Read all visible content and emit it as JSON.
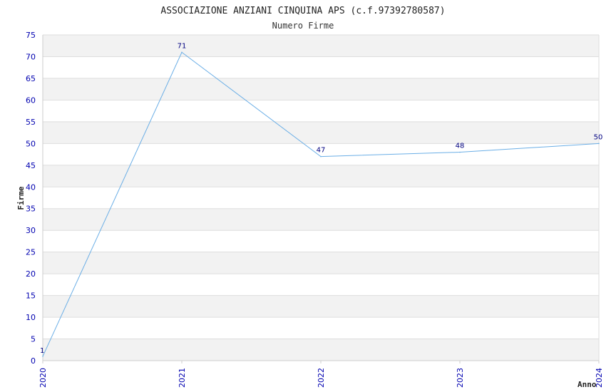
{
  "chart_data": {
    "type": "line",
    "title": "ASSOCIAZIONE ANZIANI CINQUINA APS (c.f.97392780587)",
    "subtitle": "Numero Firme",
    "xlabel": "Anno",
    "ylabel": "Firme",
    "x": [
      "2020",
      "2021",
      "2022",
      "2023",
      "2024"
    ],
    "series": [
      {
        "values": [
          1,
          71,
          47,
          48,
          50
        ]
      }
    ],
    "data_labels": [
      "1",
      "71",
      "47",
      "48",
      "50"
    ],
    "ylim": [
      0,
      75
    ],
    "yticks": [
      0,
      5,
      10,
      15,
      20,
      25,
      30,
      35,
      40,
      45,
      50,
      55,
      60,
      65,
      70,
      75
    ],
    "grid": "horizontal alternating bands",
    "colors": {
      "line": "#6aaee6",
      "tick_label": "#0000b0",
      "data_label": "#000080",
      "band": "#f2f2f2",
      "gridline": "#dddddd",
      "text": "#222222"
    }
  }
}
